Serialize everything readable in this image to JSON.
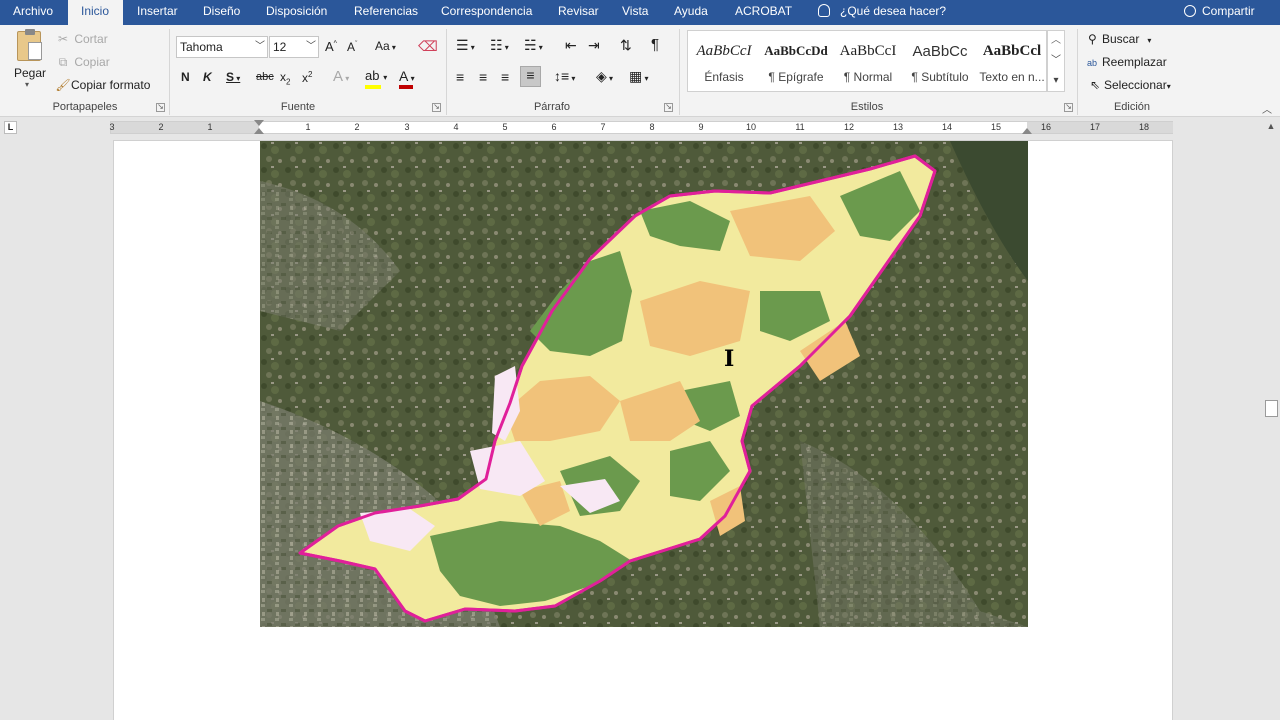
{
  "tabs": {
    "archivo": "Archivo",
    "inicio": "Inicio",
    "insertar": "Insertar",
    "diseno": "Diseño",
    "disposicion": "Disposición",
    "referencias": "Referencias",
    "correspondencia": "Correspondencia",
    "revisar": "Revisar",
    "vista": "Vista",
    "ayuda": "Ayuda",
    "acrobat": "ACROBAT",
    "tell_me": "¿Qué desea hacer?",
    "share": "Compartir"
  },
  "clipboard": {
    "paste": "Pegar",
    "cut": "Cortar",
    "copy": "Copiar",
    "format_painter": "Copiar formato",
    "group_label": "Portapapeles"
  },
  "font": {
    "name": "Tahoma",
    "size": "12",
    "group_label": "Fuente",
    "bold": "N",
    "italic": "K",
    "underline": "S",
    "strike": "abc",
    "change_case": "Aa"
  },
  "paragraph": {
    "group_label": "Párrafo"
  },
  "styles": {
    "group_label": "Estilos",
    "items": [
      {
        "preview": "AaBbCcI",
        "name": "Énfasis"
      },
      {
        "preview": "AaBbCcDd",
        "name": "¶ Epígrafe"
      },
      {
        "preview": "AaBbCcI",
        "name": "¶ Normal"
      },
      {
        "preview": "AaBbCc",
        "name": "¶ Subtítulo"
      },
      {
        "preview": "AaBbCcl",
        "name": "Texto en n..."
      }
    ]
  },
  "editing": {
    "find": "Buscar",
    "replace": "Reemplazar",
    "select": "Seleccionar",
    "group_label": "Edición"
  },
  "ruler": {
    "left_numbers": [
      "3",
      "2",
      "1"
    ],
    "right_numbers": [
      "1",
      "2",
      "3",
      "4",
      "5",
      "6",
      "7",
      "8",
      "9",
      "10",
      "11",
      "12",
      "13",
      "14",
      "15",
      "16",
      "17",
      "18"
    ]
  },
  "colors": {
    "accent": "#2b579a",
    "boundary": "#e0209a",
    "zone_green": "#6b9a4d",
    "zone_orange": "#f1c27a",
    "zone_yellow": "#f2ea9e",
    "zone_pink": "#f8e8f4"
  }
}
